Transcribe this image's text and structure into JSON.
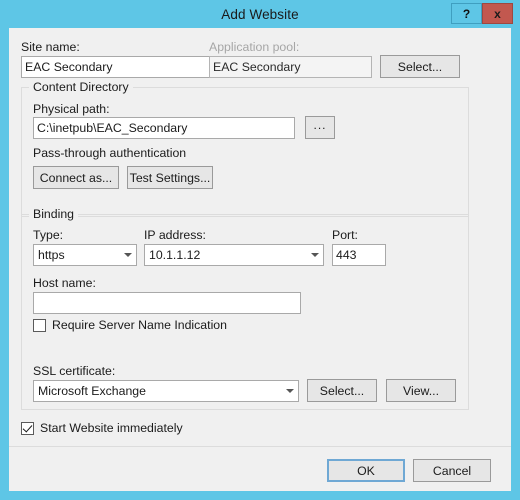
{
  "window": {
    "title": "Add Website",
    "help_button": "?",
    "close_button": "x",
    "titlebar_color": "#5ec6e6",
    "close_button_color": "#c2584f",
    "body_color": "#f0f0f0"
  },
  "site_name": {
    "label": "Site name:",
    "value": "EAC Secondary"
  },
  "application_pool": {
    "label": "Application pool:",
    "value": "EAC Secondary",
    "select_button": "Select...",
    "disabled": true
  },
  "content_directory": {
    "group_title": "Content Directory",
    "physical_path": {
      "label": "Physical path:",
      "value": "C:\\inetpub\\EAC_Secondary",
      "browse_button": "..."
    },
    "pass_through_label": "Pass-through authentication",
    "connect_as_button": "Connect as...",
    "test_settings_button": "Test Settings..."
  },
  "binding": {
    "group_title": "Binding",
    "type": {
      "label": "Type:",
      "value": "https"
    },
    "ip_address": {
      "label": "IP address:",
      "value": "10.1.1.12"
    },
    "port": {
      "label": "Port:",
      "value": "443"
    },
    "host_name": {
      "label": "Host name:",
      "value": "",
      "placeholder": ""
    },
    "require_sni": {
      "label": "Require Server Name Indication",
      "checked": false
    },
    "ssl_certificate": {
      "label": "SSL certificate:",
      "value": "Microsoft Exchange",
      "select_button": "Select...",
      "view_button": "View..."
    }
  },
  "footer": {
    "start_website": {
      "label": "Start Website immediately",
      "checked": true
    },
    "ok_button": "OK",
    "cancel_button": "Cancel"
  }
}
